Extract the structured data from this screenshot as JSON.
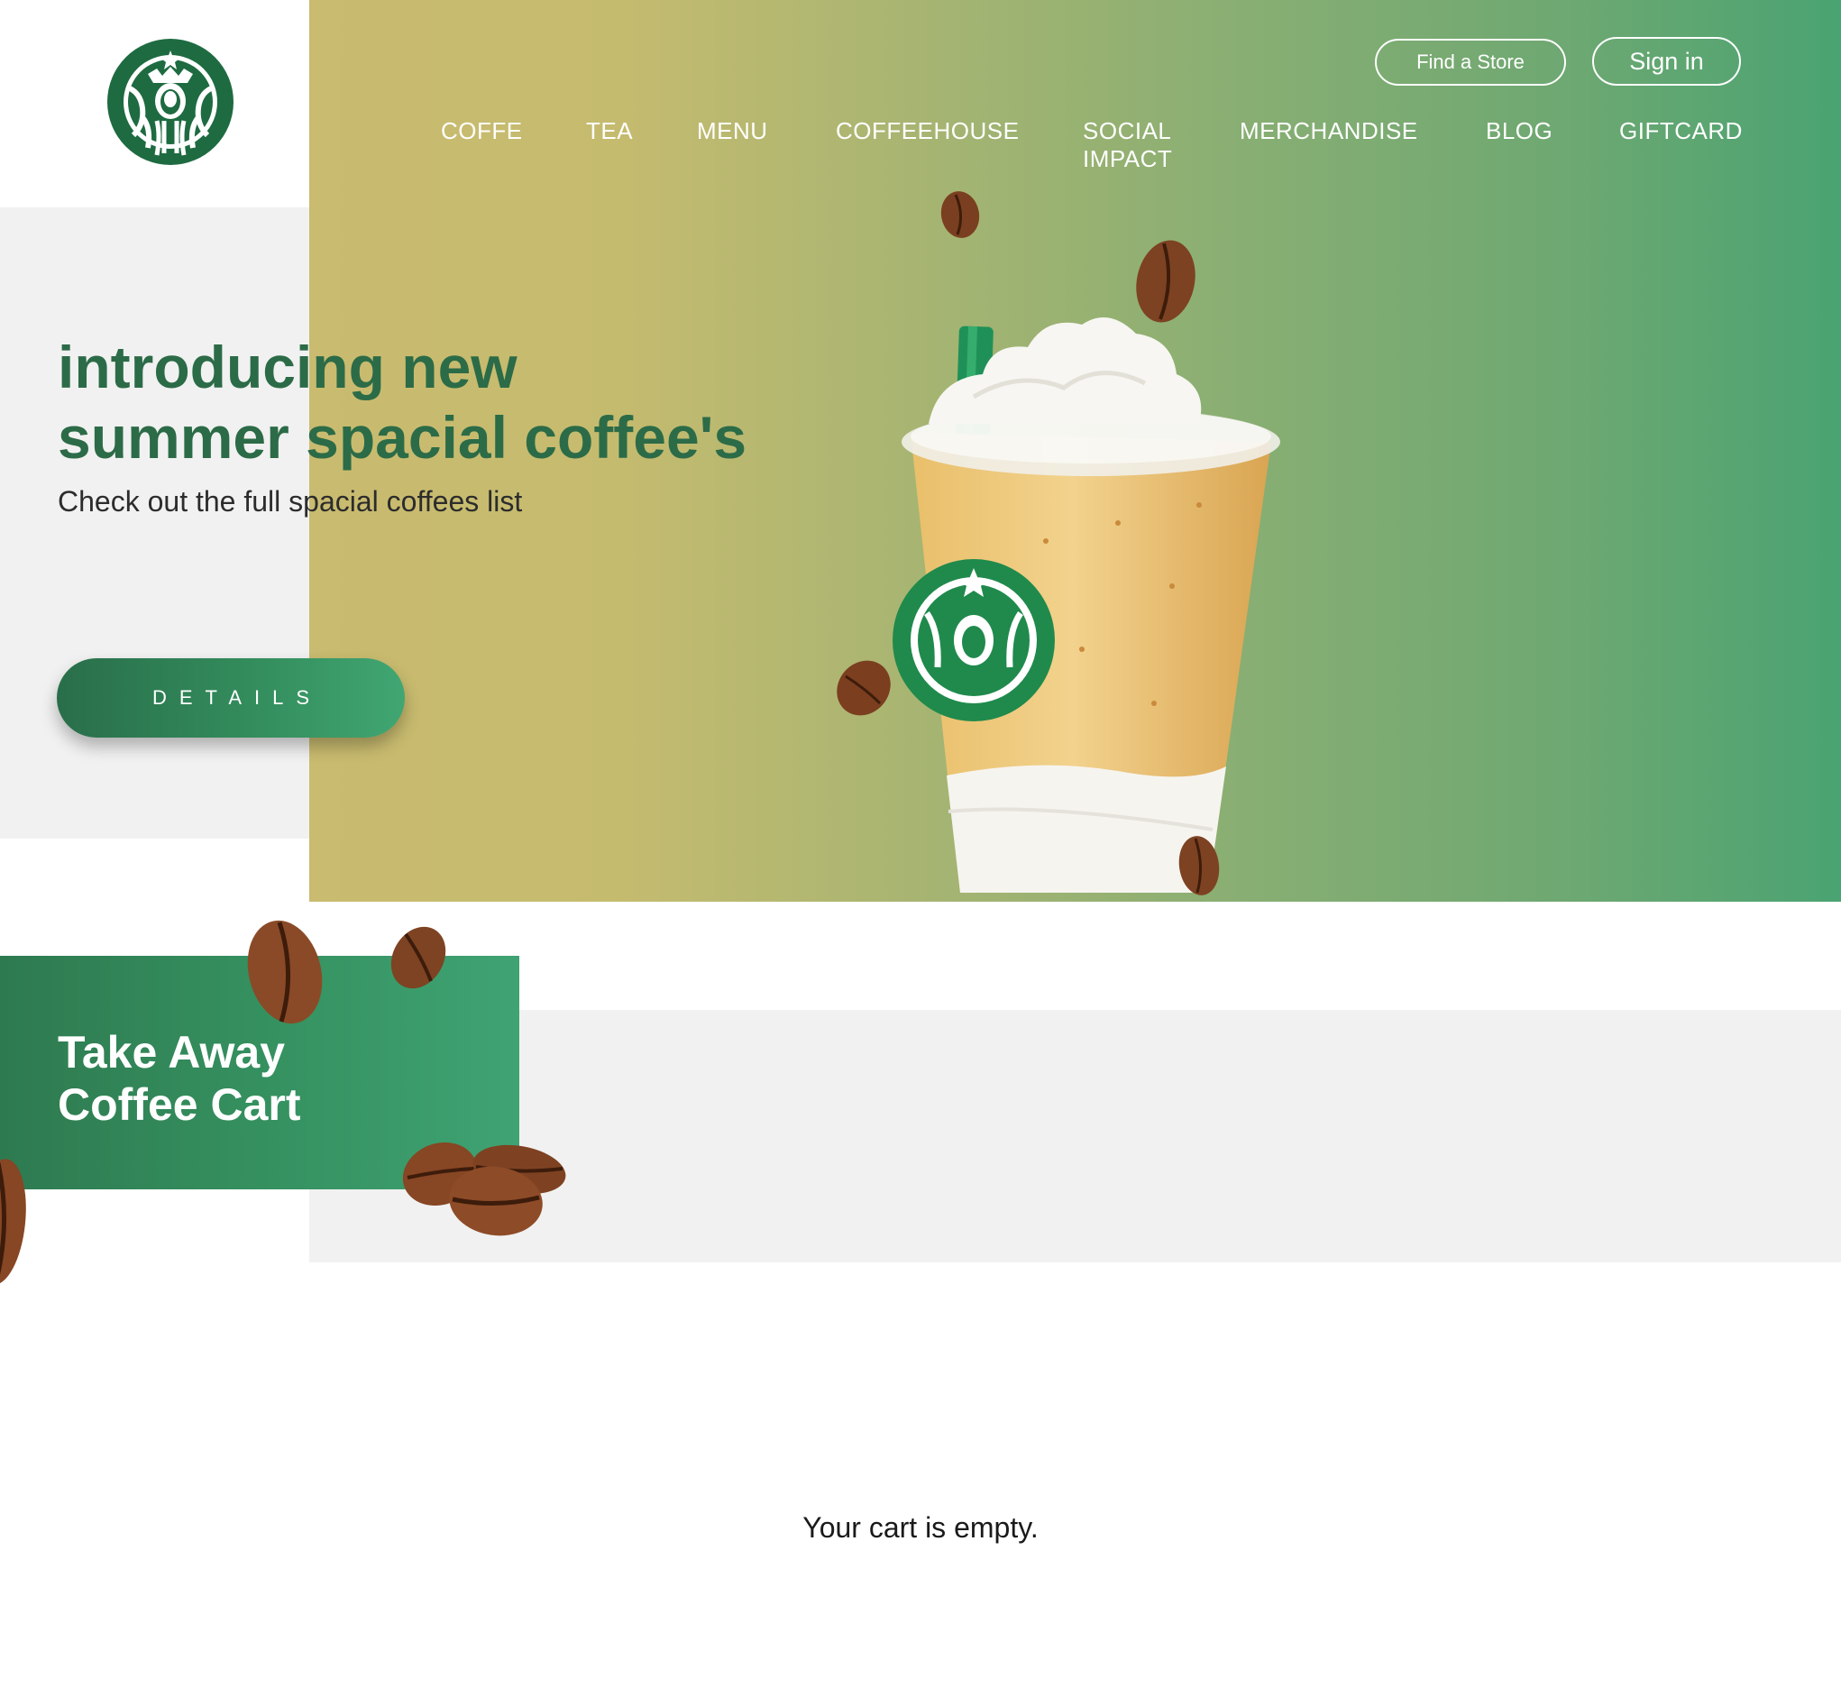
{
  "header": {
    "find_store_label": "Find a Store",
    "sign_in_label": "Sign in"
  },
  "nav": {
    "items": [
      {
        "label": "COFFE"
      },
      {
        "label": "TEA"
      },
      {
        "label": "MENU"
      },
      {
        "label": "COFFEEHOUSE"
      },
      {
        "label": "SOCIAL",
        "label2": "IMPACT"
      },
      {
        "label": "MERCHANDISE"
      },
      {
        "label": "BLOG"
      },
      {
        "label": "GIFTCARD"
      }
    ]
  },
  "hero": {
    "title_line1": "introducing new",
    "title_line2": "summer spacial coffee's",
    "subtitle": "Check out the full spacial coffees list",
    "details_label": "DETAILS"
  },
  "cart": {
    "title_line1": "Take Away",
    "title_line2": "Coffee Cart",
    "empty_message": "Your cart is empty."
  },
  "colors": {
    "brand_green": "#2c6b47",
    "accent_green": "#3fa373",
    "gold": "#c9bb6f",
    "light_gray": "#f1f1f1"
  },
  "icons": {
    "logo": "siren-logo-icon",
    "hero_image": "frappuccino-cup-image",
    "beans": "coffee-bean-icon"
  }
}
